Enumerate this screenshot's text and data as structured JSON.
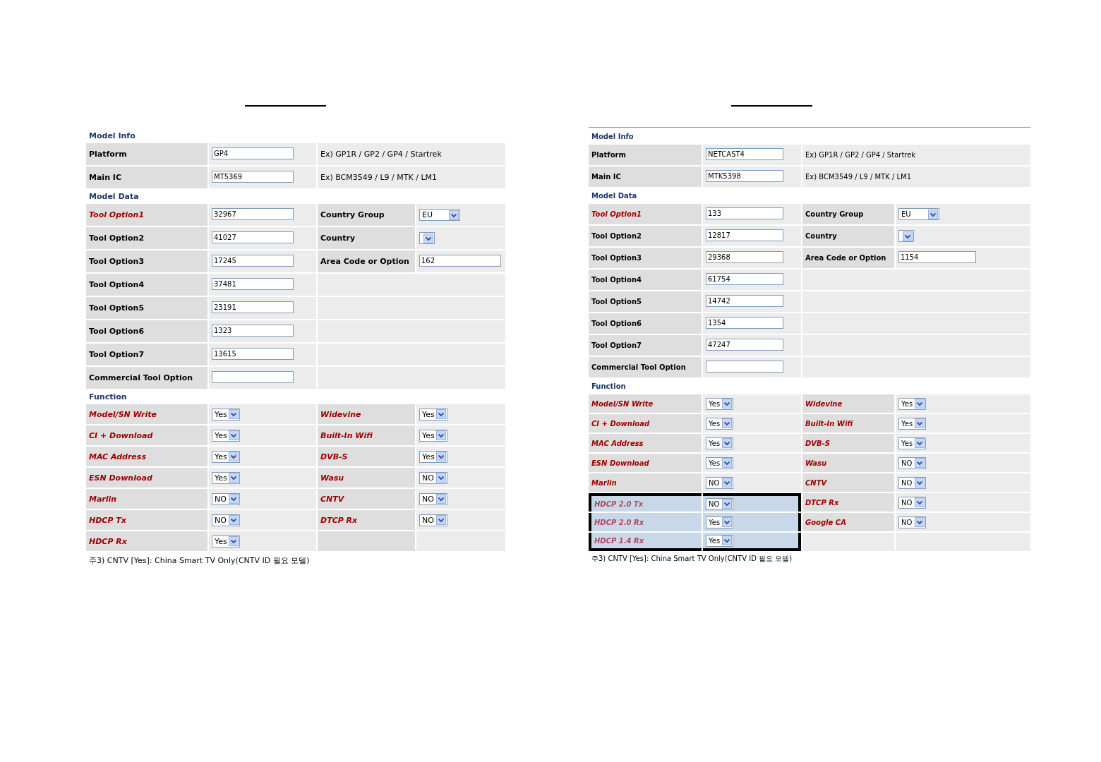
{
  "panels": [
    {
      "sections": [
        {
          "title": "Model Info",
          "rows": [
            {
              "label": "Platform",
              "required": false,
              "highlighted": false,
              "field": {
                "kind": "text",
                "value": "GP4"
              },
              "extra": {
                "kind": "hint",
                "text": "Ex) GP1R / GP2 / GP4 / Startrek"
              }
            },
            {
              "label": "Main IC",
              "required": false,
              "highlighted": false,
              "field": {
                "kind": "text",
                "value": "MT5369"
              },
              "extra": {
                "kind": "hint",
                "text": "Ex) BCM3549 / L9 / MTK / LM1"
              }
            }
          ]
        },
        {
          "title": "Model Data",
          "rows": [
            {
              "label": "Tool Option1",
              "required": true,
              "highlighted": false,
              "field": {
                "kind": "text",
                "value": "32967"
              },
              "extra": {
                "kind": "pair",
                "label": "Country Group",
                "required": false,
                "field": {
                  "kind": "select",
                  "value": "EU",
                  "wide": true
                }
              }
            },
            {
              "label": "Tool Option2",
              "required": false,
              "highlighted": false,
              "field": {
                "kind": "text",
                "value": "41027"
              },
              "extra": {
                "kind": "pair",
                "label": "Country",
                "required": false,
                "field": {
                  "kind": "select"
                }
              }
            },
            {
              "label": "Tool Option3",
              "required": false,
              "highlighted": false,
              "field": {
                "kind": "text",
                "value": "17245"
              },
              "extra": {
                "kind": "pair",
                "label": "Area Code or Option",
                "required": false,
                "field": {
                  "kind": "text",
                  "value": "162"
                }
              }
            },
            {
              "label": "Tool Option4",
              "required": false,
              "highlighted": false,
              "field": {
                "kind": "text",
                "value": "37481"
              },
              "extra": {
                "kind": "none"
              }
            },
            {
              "label": "Tool Option5",
              "required": false,
              "highlighted": false,
              "field": {
                "kind": "text",
                "value": "23191"
              },
              "extra": {
                "kind": "none"
              }
            },
            {
              "label": "Tool Option6",
              "required": false,
              "highlighted": false,
              "field": {
                "kind": "text",
                "value": "1323"
              },
              "extra": {
                "kind": "none"
              }
            },
            {
              "label": "Tool Option7",
              "required": false,
              "highlighted": false,
              "field": {
                "kind": "text",
                "value": "13615"
              },
              "extra": {
                "kind": "none"
              }
            },
            {
              "label": "Commercial Tool Option",
              "required": false,
              "highlighted": false,
              "field": {
                "kind": "text"
              },
              "extra": {
                "kind": "none"
              }
            }
          ]
        },
        {
          "title": "Function",
          "rows": [
            {
              "label": "Model/SN Write",
              "required": true,
              "highlighted": false,
              "field": {
                "kind": "select",
                "value": "Yes"
              },
              "extra": {
                "kind": "pair",
                "label": "Widevine",
                "required": true,
                "field": {
                  "kind": "select",
                  "value": "Yes"
                }
              }
            },
            {
              "label": "CI + Download",
              "required": true,
              "highlighted": false,
              "field": {
                "kind": "select",
                "value": "Yes"
              },
              "extra": {
                "kind": "pair",
                "label": "Built-In Wifi",
                "required": true,
                "field": {
                  "kind": "select",
                  "value": "Yes"
                }
              }
            },
            {
              "label": "MAC Address",
              "required": true,
              "highlighted": false,
              "field": {
                "kind": "select",
                "value": "Yes"
              },
              "extra": {
                "kind": "pair",
                "label": "DVB-S",
                "required": true,
                "field": {
                  "kind": "select",
                  "value": "Yes"
                }
              }
            },
            {
              "label": "ESN Download",
              "required": true,
              "highlighted": false,
              "field": {
                "kind": "select",
                "value": "Yes"
              },
              "extra": {
                "kind": "pair",
                "label": "Wasu",
                "required": true,
                "field": {
                  "kind": "select",
                  "value": "NO"
                }
              }
            },
            {
              "label": "Marlin",
              "required": true,
              "highlighted": false,
              "field": {
                "kind": "select",
                "value": "NO"
              },
              "extra": {
                "kind": "pair",
                "label": "CNTV",
                "required": true,
                "field": {
                  "kind": "select",
                  "value": "NO"
                }
              }
            },
            {
              "label": "HDCP Tx",
              "required": true,
              "highlighted": false,
              "field": {
                "kind": "select",
                "value": "NO"
              },
              "extra": {
                "kind": "pair",
                "label": "DTCP Rx",
                "required": true,
                "field": {
                  "kind": "select",
                  "value": "NO"
                }
              }
            },
            {
              "label": "HDCP Rx",
              "required": true,
              "highlighted": false,
              "field": {
                "kind": "select",
                "value": "Yes"
              },
              "extra": {
                "kind": "empty"
              }
            }
          ]
        }
      ],
      "footnote": "주3) CNTV [Yes]: China Smart TV Only(CNTV ID 필요 모델)"
    },
    {
      "sections": [
        {
          "title": "Model Info",
          "rows": [
            {
              "label": "Platform",
              "required": false,
              "highlighted": false,
              "field": {
                "kind": "text",
                "value": "NETCAST4"
              },
              "extra": {
                "kind": "hint",
                "text": "Ex) GP1R / GP2 / GP4 / Startrek"
              }
            },
            {
              "label": "Main IC",
              "required": false,
              "highlighted": false,
              "field": {
                "kind": "text",
                "value": "MTK5398"
              },
              "extra": {
                "kind": "hint",
                "text": "Ex) BCM3549 / L9 / MTK / LM1"
              }
            }
          ]
        },
        {
          "title": "Model Data",
          "rows": [
            {
              "label": "Tool Option1",
              "required": true,
              "highlighted": false,
              "field": {
                "kind": "text",
                "value": "133"
              },
              "extra": {
                "kind": "pair",
                "label": "Country Group",
                "required": false,
                "field": {
                  "kind": "select",
                  "value": "EU",
                  "wide": true
                }
              }
            },
            {
              "label": "Tool Option2",
              "required": false,
              "highlighted": false,
              "field": {
                "kind": "text",
                "value": "12817"
              },
              "extra": {
                "kind": "pair",
                "label": "Country",
                "required": false,
                "field": {
                  "kind": "select"
                }
              }
            },
            {
              "label": "Tool Option3",
              "required": false,
              "highlighted": false,
              "field": {
                "kind": "text",
                "value": "29368"
              },
              "extra": {
                "kind": "pair",
                "label": "Area Code or Option",
                "required": false,
                "field": {
                  "kind": "text",
                  "value": "1154"
                }
              }
            },
            {
              "label": "Tool Option4",
              "required": false,
              "highlighted": false,
              "field": {
                "kind": "text",
                "value": "61754"
              },
              "extra": {
                "kind": "none"
              }
            },
            {
              "label": "Tool Option5",
              "required": false,
              "highlighted": false,
              "field": {
                "kind": "text",
                "value": "14742"
              },
              "extra": {
                "kind": "none"
              }
            },
            {
              "label": "Tool Option6",
              "required": false,
              "highlighted": false,
              "field": {
                "kind": "text",
                "value": "1354"
              },
              "extra": {
                "kind": "none"
              }
            },
            {
              "label": "Tool Option7",
              "required": false,
              "highlighted": false,
              "field": {
                "kind": "text",
                "value": "47247"
              },
              "extra": {
                "kind": "none"
              }
            },
            {
              "label": "Commercial Tool Option",
              "required": false,
              "highlighted": false,
              "field": {
                "kind": "text"
              },
              "extra": {
                "kind": "none"
              }
            }
          ]
        },
        {
          "title": "Function",
          "rows": [
            {
              "label": "Model/SN Write",
              "required": true,
              "highlighted": false,
              "field": {
                "kind": "select",
                "value": "Yes"
              },
              "extra": {
                "kind": "pair",
                "label": "Widevine",
                "required": true,
                "field": {
                  "kind": "select",
                  "value": "Yes"
                }
              }
            },
            {
              "label": "CI + Download",
              "required": true,
              "highlighted": false,
              "field": {
                "kind": "select",
                "value": "Yes"
              },
              "extra": {
                "kind": "pair",
                "label": "Built-In Wifi",
                "required": true,
                "field": {
                  "kind": "select",
                  "value": "Yes"
                }
              }
            },
            {
              "label": "MAC Address",
              "required": true,
              "highlighted": false,
              "field": {
                "kind": "select",
                "value": "Yes"
              },
              "extra": {
                "kind": "pair",
                "label": "DVB-S",
                "required": true,
                "field": {
                  "kind": "select",
                  "value": "Yes"
                }
              }
            },
            {
              "label": "ESN Download",
              "required": true,
              "highlighted": false,
              "field": {
                "kind": "select",
                "value": "Yes"
              },
              "extra": {
                "kind": "pair",
                "label": "Wasu",
                "required": true,
                "field": {
                  "kind": "select",
                  "value": "NO"
                }
              }
            },
            {
              "label": "Marlin",
              "required": true,
              "highlighted": false,
              "field": {
                "kind": "select",
                "value": "NO"
              },
              "extra": {
                "kind": "pair",
                "label": "CNTV",
                "required": true,
                "field": {
                  "kind": "select",
                  "value": "NO"
                }
              }
            },
            {
              "label": "HDCP 2.0 Tx",
              "required": true,
              "highlighted": true,
              "field": {
                "kind": "select",
                "value": "NO"
              },
              "extra": {
                "kind": "pair",
                "label": "DTCP Rx",
                "required": true,
                "field": {
                  "kind": "select",
                  "value": "NO"
                }
              }
            },
            {
              "label": "HDCP 2.0 Rx",
              "required": true,
              "highlighted": true,
              "field": {
                "kind": "select",
                "value": "Yes"
              },
              "extra": {
                "kind": "pair",
                "label": "Google CA",
                "required": true,
                "field": {
                  "kind": "select",
                  "value": "NO"
                }
              }
            },
            {
              "label": "HDCP 1.4 Rx",
              "required": true,
              "highlighted": true,
              "field": {
                "kind": "select",
                "value": "Yes"
              },
              "extra": {
                "kind": "empty"
              }
            }
          ]
        }
      ],
      "footnote": "주3) CNTV [Yes]: China Smart TV Only(CNTV ID 필요 모델)"
    }
  ]
}
